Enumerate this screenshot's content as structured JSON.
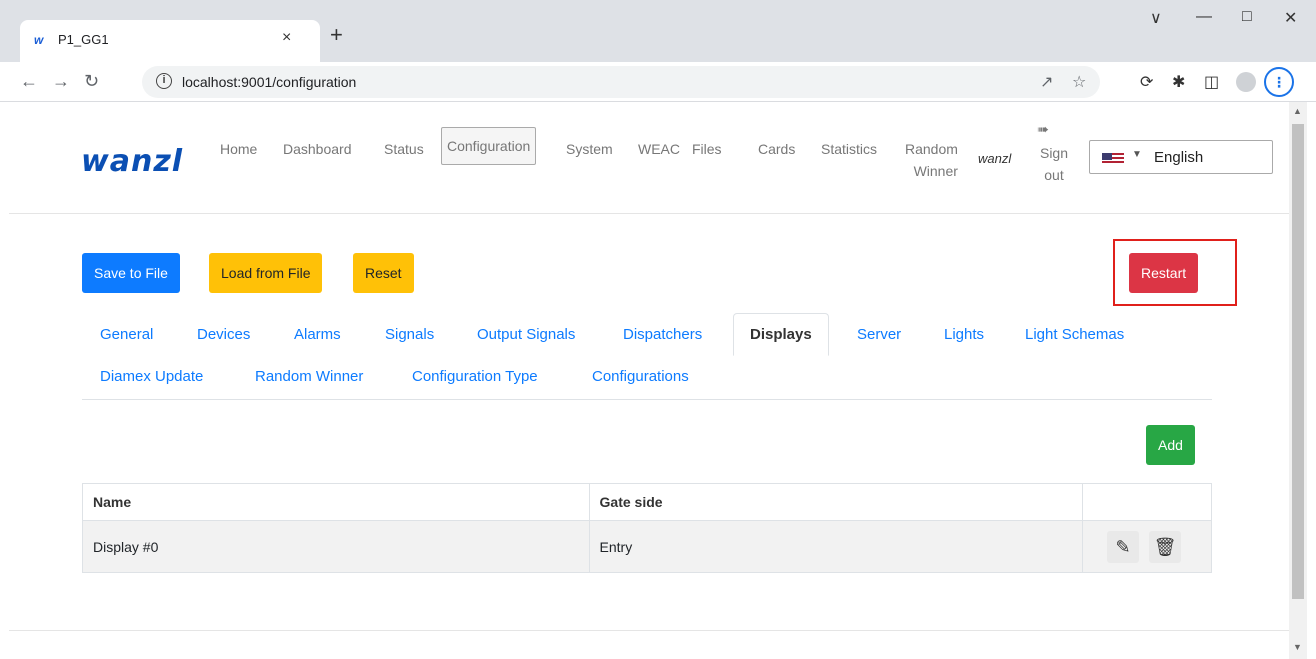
{
  "browser": {
    "tab_title": "P1_GG1",
    "tab_favicon": "w",
    "close_glyph": "×",
    "newtab_glyph": "+",
    "url": "localhost:9001/configuration",
    "icons": [
      "back-icon",
      "forward-icon",
      "reload-icon",
      "info-icon",
      "share-icon",
      "star-icon",
      "extension-icon",
      "puzzle-icon",
      "sidepanel-icon",
      "profile-icon",
      "menu-icon"
    ]
  },
  "header": {
    "logo": "wanzl",
    "nav": [
      "Home",
      "Dashboard",
      "Status",
      "Configuration",
      "System",
      "WEAC",
      "Files",
      "Cards",
      "Statistics"
    ],
    "nav_random_1": "Random",
    "nav_random_2": "Winner",
    "active_nav": "Configuration",
    "user": "wanzl",
    "signout_1": "Sign",
    "signout_2": "out",
    "language": "English"
  },
  "actions": {
    "save": "Save to File",
    "load": "Load from File",
    "reset": "Reset",
    "restart": "Restart"
  },
  "tabs": {
    "row1": [
      "General",
      "Devices",
      "Alarms",
      "Signals",
      "Output Signals",
      "Dispatchers",
      "Displays",
      "Server",
      "Lights",
      "Light Schemas"
    ],
    "row2": [
      "Diamex Update",
      "Random Winner",
      "Configuration Type",
      "Configurations"
    ],
    "active": "Displays"
  },
  "add_label": "Add",
  "table": {
    "headers": [
      "Name",
      "Gate side",
      ""
    ],
    "rows": [
      {
        "name": "Display #0",
        "gate_side": "Entry"
      }
    ]
  },
  "colors": {
    "primary": "#0d7bff",
    "warning": "#ffc107",
    "danger": "#dc3545",
    "success": "#28a745",
    "highlight": "#e0201b"
  }
}
